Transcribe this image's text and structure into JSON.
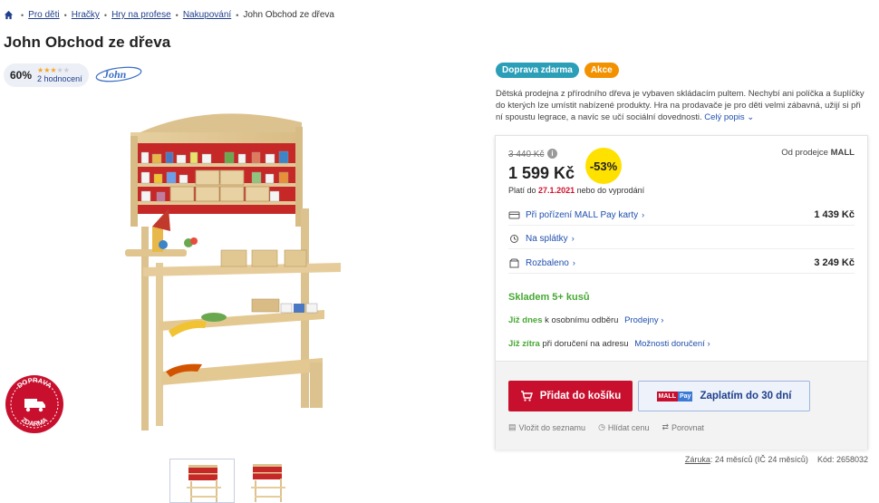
{
  "breadcrumb": {
    "items": [
      "Pro děti",
      "Hračky",
      "Hry na profese",
      "Nakupování"
    ],
    "current": "John Obchod ze dřeva"
  },
  "product": {
    "title": "John Obchod ze dřeva",
    "rating_percent": "60%",
    "rating_stars": 3,
    "rating_count": "2 hodnocení",
    "brand": "John",
    "badge_free_top": "DOPRAVA",
    "badge_free_bottom": "ZDARMA"
  },
  "tags": [
    "Doprava zdarma",
    "Akce"
  ],
  "description": {
    "text": "Dětská prodejna z přírodního dřeva je vybaven skládacím pultem. Nechybí ani políčka a šuplíčky do kterých lze umístit nabízené produkty. Hra na prodavače je pro děti velmi zábavná, užijí si při ní spoustu legrace, a navíc se učí sociální dovednosti.",
    "more_link": "Celý popis"
  },
  "price_box": {
    "old_price": "3 440 Kč",
    "price": "1 599 Kč",
    "discount": "-53%",
    "seller_label": "Od prodejce",
    "seller_name": "MALL",
    "valid_prefix": "Platí do",
    "valid_date": "27.1.2021",
    "valid_suffix": "nebo do vyprodání",
    "options": [
      {
        "label": "Při pořízení MALL Pay karty",
        "value": "1 439 Kč"
      },
      {
        "label": "Na splátky",
        "value": ""
      },
      {
        "label": "Rozbaleno",
        "value": "3 249 Kč"
      }
    ],
    "stock": "Skladem 5+ kusů",
    "delivery1_bold": "Již dnes",
    "delivery1_text": "k osobnímu odběru",
    "delivery1_link": "Prodejny",
    "delivery2_bold": "Již zítra",
    "delivery2_text": "při doručení na adresu",
    "delivery2_link": "Možnosti doručení",
    "cart_button": "Přidat do košíku",
    "pay_button": "Zaplatím do 30 dní",
    "mallpay_m": "MALL",
    "mallpay_p": "Pay",
    "actions": [
      "Vložit do seznamu",
      "Hlídat cenu",
      "Porovnat"
    ]
  },
  "footer": {
    "warranty_label": "Záruka",
    "warranty_value": ": 24 měsíců (IČ 24 měsíců)",
    "code": "Kód: 2658032"
  },
  "colors": {
    "accent_red": "#c8102e",
    "link_blue": "#1f4fae",
    "stock_green": "#47a834",
    "tag_blue": "#2c9fb8",
    "tag_orange": "#f39200",
    "discount_yellow": "#ffe100"
  }
}
